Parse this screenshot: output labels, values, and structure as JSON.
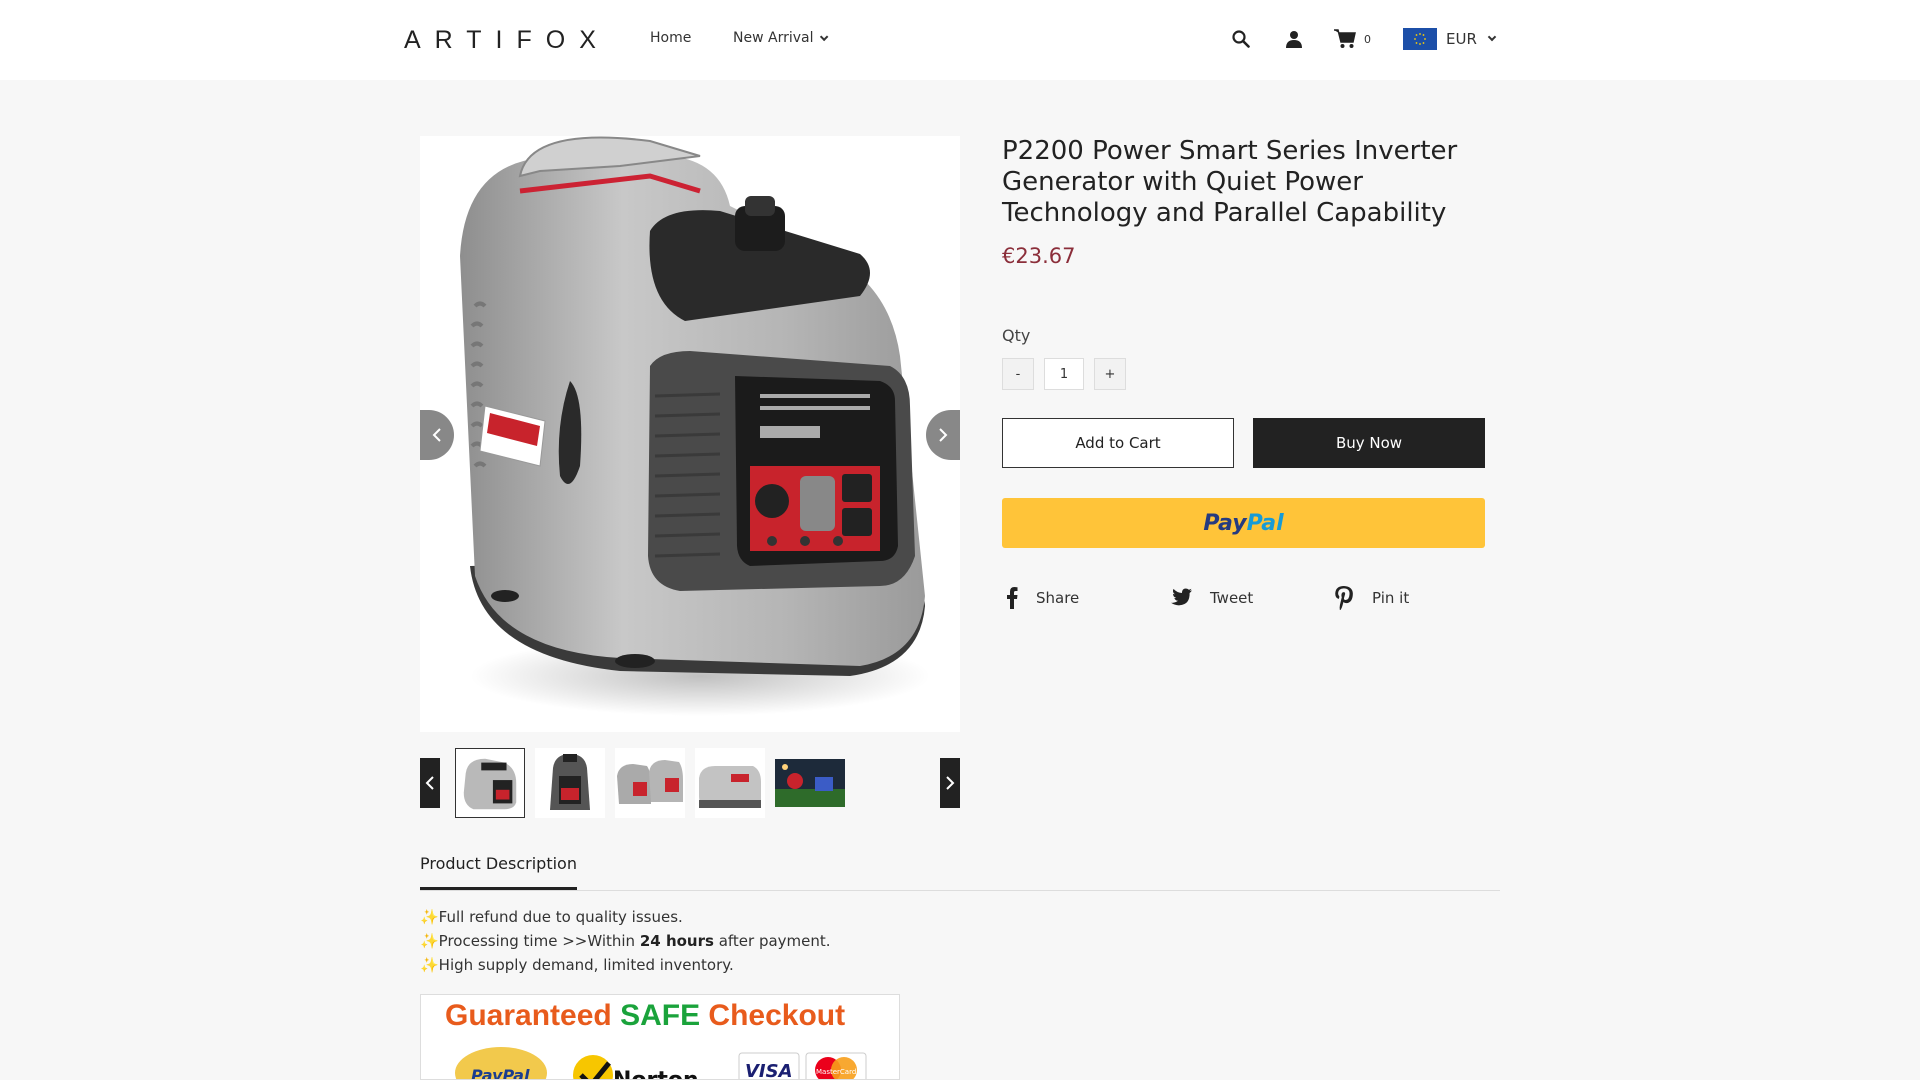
{
  "header": {
    "logo": "ARTIFOX",
    "nav": {
      "home": "Home",
      "new_arrival": "New Arrival"
    },
    "cart_count": "0",
    "currency": "EUR"
  },
  "product": {
    "title": "P2200 Power Smart Series Inverter Generator with Quiet Power Technology and Parallel Capability",
    "price": "€23.67",
    "qty_label": "Qty",
    "qty_minus": "-",
    "qty_value": "1",
    "qty_plus": "+",
    "add_to_cart": "Add to Cart",
    "buy_now": "Buy Now",
    "paypal_pay": "Pay",
    "paypal_pal": "Pal",
    "share": {
      "facebook": "Share",
      "twitter": "Tweet",
      "pinterest": "Pin it"
    }
  },
  "description": {
    "tab_label": "Product Description",
    "line1": "✨Full refund due to quality issues.",
    "line2_pre": "✨Processing time  >>Within ",
    "line2_bold": "24 hours",
    "line2_post": " after payment.",
    "line3": "✨High  supply demand, limited inventory.",
    "banner_part1": "Guaranteed ",
    "banner_part2": "SAFE",
    "banner_part3": " Checkout",
    "banner_badges": [
      "PayPal",
      "Norton",
      "VISA",
      "MasterCard"
    ]
  },
  "colors": {
    "price": "#8b2e3a",
    "paypal_yellow": "#ffc439",
    "dark": "#222222"
  }
}
